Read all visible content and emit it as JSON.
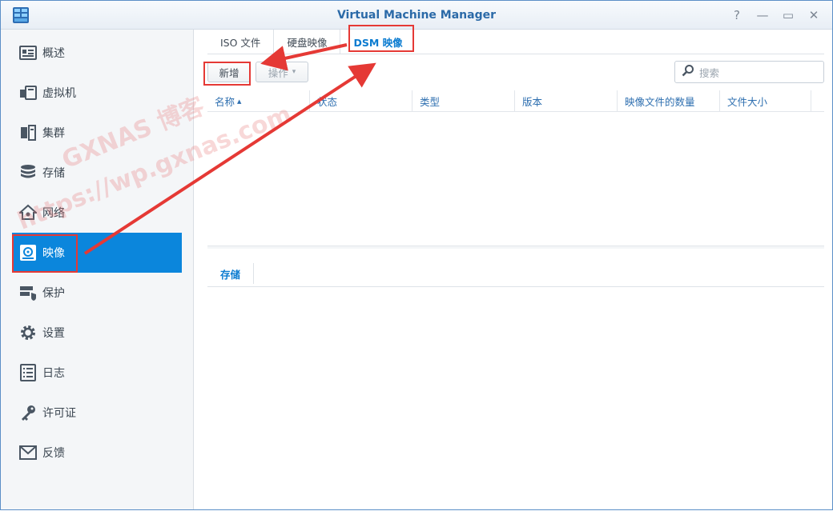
{
  "window": {
    "title": "Virtual Machine Manager"
  },
  "window_buttons": {
    "help": "?",
    "minimize": "—",
    "maximize": "▭",
    "close": "✕"
  },
  "sidebar": {
    "items": [
      {
        "label": "概述",
        "icon": "overview-icon"
      },
      {
        "label": "虚拟机",
        "icon": "virtual-machine-icon"
      },
      {
        "label": "集群",
        "icon": "cluster-icon"
      },
      {
        "label": "存储",
        "icon": "storage-icon"
      },
      {
        "label": "网络",
        "icon": "network-icon"
      },
      {
        "label": "映像",
        "icon": "image-icon",
        "active": true
      },
      {
        "label": "保护",
        "icon": "protection-icon"
      },
      {
        "label": "设置",
        "icon": "settings-icon"
      },
      {
        "label": "日志",
        "icon": "log-icon"
      },
      {
        "label": "许可证",
        "icon": "license-key-icon"
      },
      {
        "label": "反馈",
        "icon": "feedback-mail-icon"
      }
    ]
  },
  "tabs": [
    {
      "label": "ISO 文件"
    },
    {
      "label": "硬盘映像"
    },
    {
      "label": "DSM 映像",
      "active": true
    }
  ],
  "toolbar": {
    "add_label": "新增",
    "action_label": "操作",
    "action_caret": "▾"
  },
  "search": {
    "placeholder": "搜索"
  },
  "table": {
    "columns": [
      "名称",
      "状态",
      "类型",
      "版本",
      "映像文件的数量",
      "文件大小"
    ],
    "sort_indicator": "▲"
  },
  "detail_tabs": [
    {
      "label": "存储"
    }
  ],
  "watermark": {
    "line1": "GXNAS 博客",
    "line2": "https://wp.gxnas.com"
  },
  "colors": {
    "accent": "#0b86dc",
    "highlight": "#e53935",
    "title": "#2b6aa8"
  }
}
